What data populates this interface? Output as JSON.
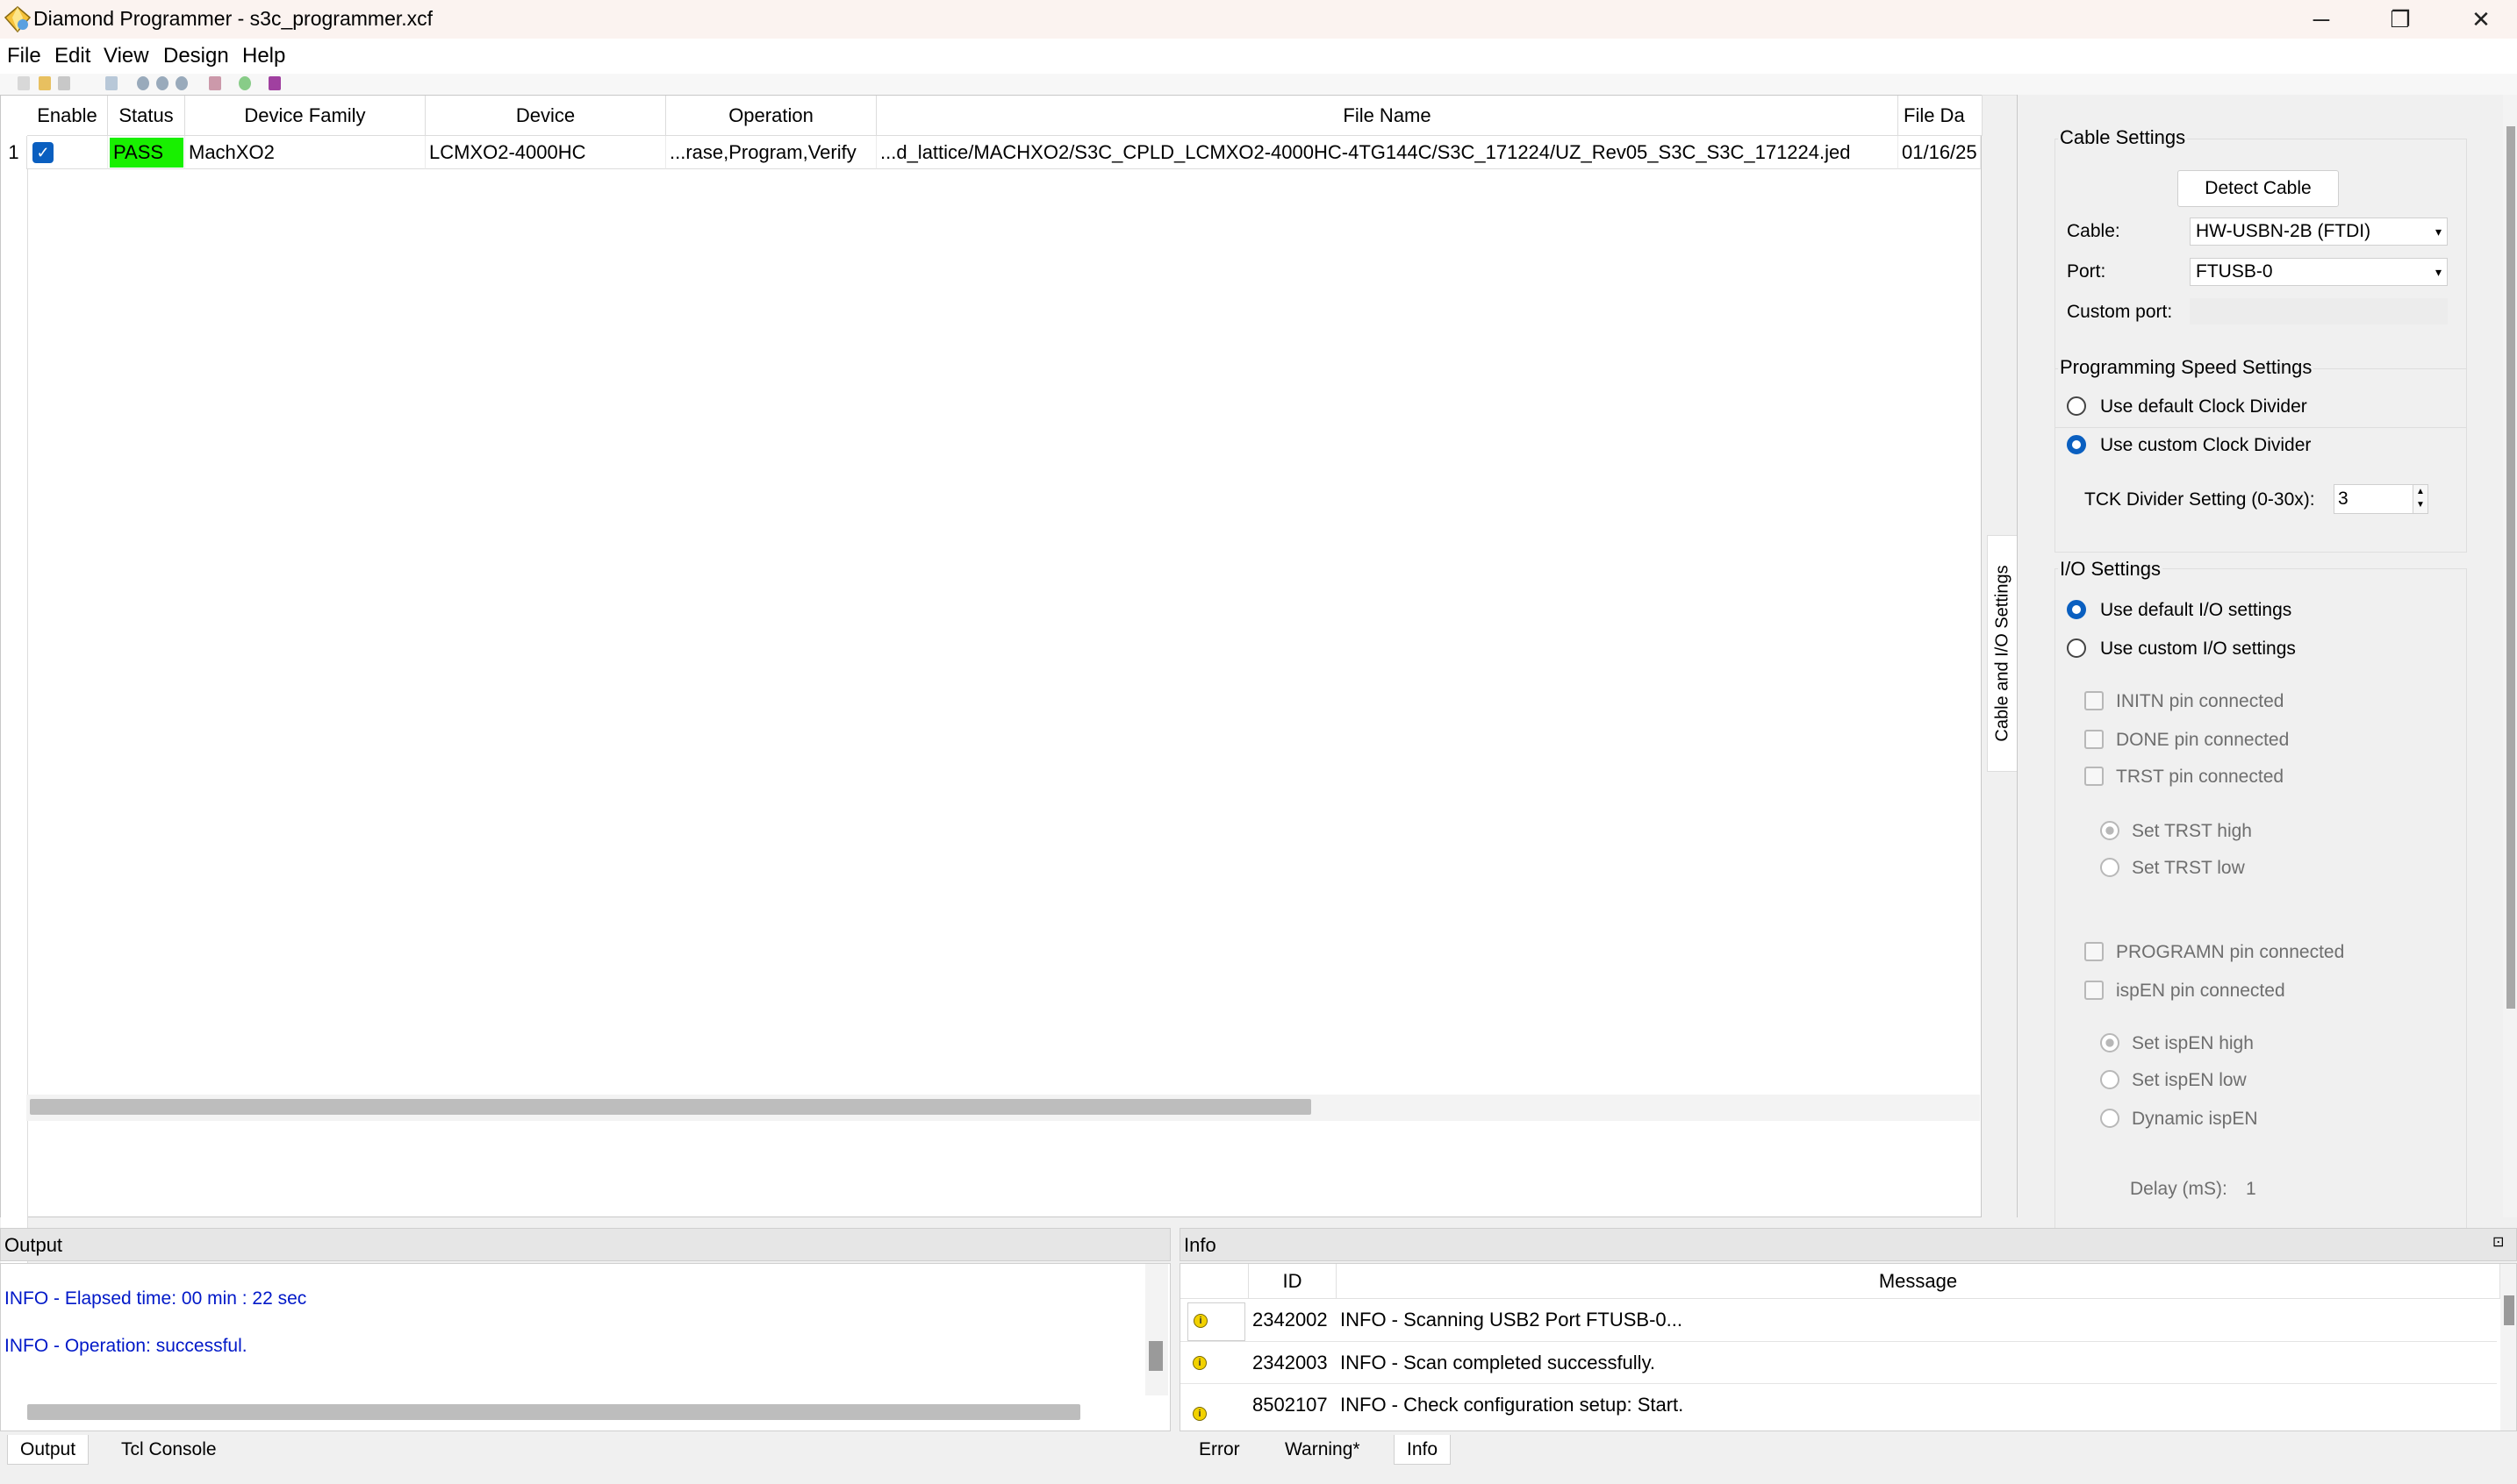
{
  "window": {
    "title": "Diamond Programmer - s3c_programmer.xcf",
    "minimize_glyph": "─",
    "restore_glyph": "❐",
    "close_glyph": "✕"
  },
  "menubar": {
    "items": [
      "File",
      "Edit",
      "View",
      "Design",
      "Help"
    ]
  },
  "device_table": {
    "columns": [
      "Enable",
      "Status",
      "Device Family",
      "Device",
      "Operation",
      "File Name",
      "File Da"
    ],
    "rows": [
      {
        "num": "1",
        "enabled": true,
        "status": "PASS",
        "device_family": "MachXO2",
        "device": "LCMXO2-4000HC",
        "operation": "...rase,Program,Verify",
        "file_name": "...d_lattice/MACHXO2/S3C_CPLD_LCMXO2-4000HC-4TG144C/S3C_171224/UZ_Rev05_S3C_S3C_171224.jed",
        "file_date": "01/16/25"
      }
    ],
    "status_color": "#18f000"
  },
  "side_tab": {
    "label": "Cable and I/O Settings"
  },
  "cable_settings": {
    "title": "Cable Settings",
    "detect_button": "Detect Cable",
    "cable_label": "Cable:",
    "cable_value": "HW-USBN-2B (FTDI)",
    "port_label": "Port:",
    "port_value": "FTUSB-0",
    "custom_port_label": "Custom port:",
    "custom_port_value": ""
  },
  "speed_settings": {
    "title": "Programming Speed Settings",
    "default_option": "Use default Clock Divider",
    "custom_option": "Use custom Clock Divider",
    "selected": "custom",
    "tck_label": "TCK Divider Setting (0-30x):",
    "tck_value": "3"
  },
  "io_settings": {
    "title": "I/O Settings",
    "default_option": "Use default I/O settings",
    "custom_option": "Use custom I/O settings",
    "selected": "default",
    "initn": "INITN pin connected",
    "done": "DONE pin connected",
    "trst": "TRST pin connected",
    "trst_high": "Set TRST high",
    "trst_low": "Set TRST low",
    "programn": "PROGRAMN pin connected",
    "ispen": "ispEN pin connected",
    "ispen_high": "Set ispEN high",
    "ispen_low": "Set ispEN low",
    "ispen_dynamic": "Dynamic ispEN",
    "delay_label": "Delay (mS):",
    "delay_value": "1"
  },
  "output_panel": {
    "title": "Output",
    "lines": [
      "INFO - Elapsed time: 00 min : 22 sec",
      "INFO - Operation: successful."
    ],
    "tabs": [
      "Output",
      "Tcl Console"
    ]
  },
  "info_panel": {
    "title": "Info",
    "columns": [
      "ID",
      "Message"
    ],
    "rows": [
      {
        "id": "2342002",
        "message": "INFO - Scanning USB2 Port FTUSB-0..."
      },
      {
        "id": "2342003",
        "message": "INFO - Scan completed successfully."
      },
      {
        "id": "8502107",
        "message": "INFO - Check configuration setup: Start."
      }
    ],
    "tabs": [
      "Error",
      "Warning*",
      "Info"
    ],
    "info_icon_glyph": "i",
    "dock_glyph": "⊡"
  }
}
